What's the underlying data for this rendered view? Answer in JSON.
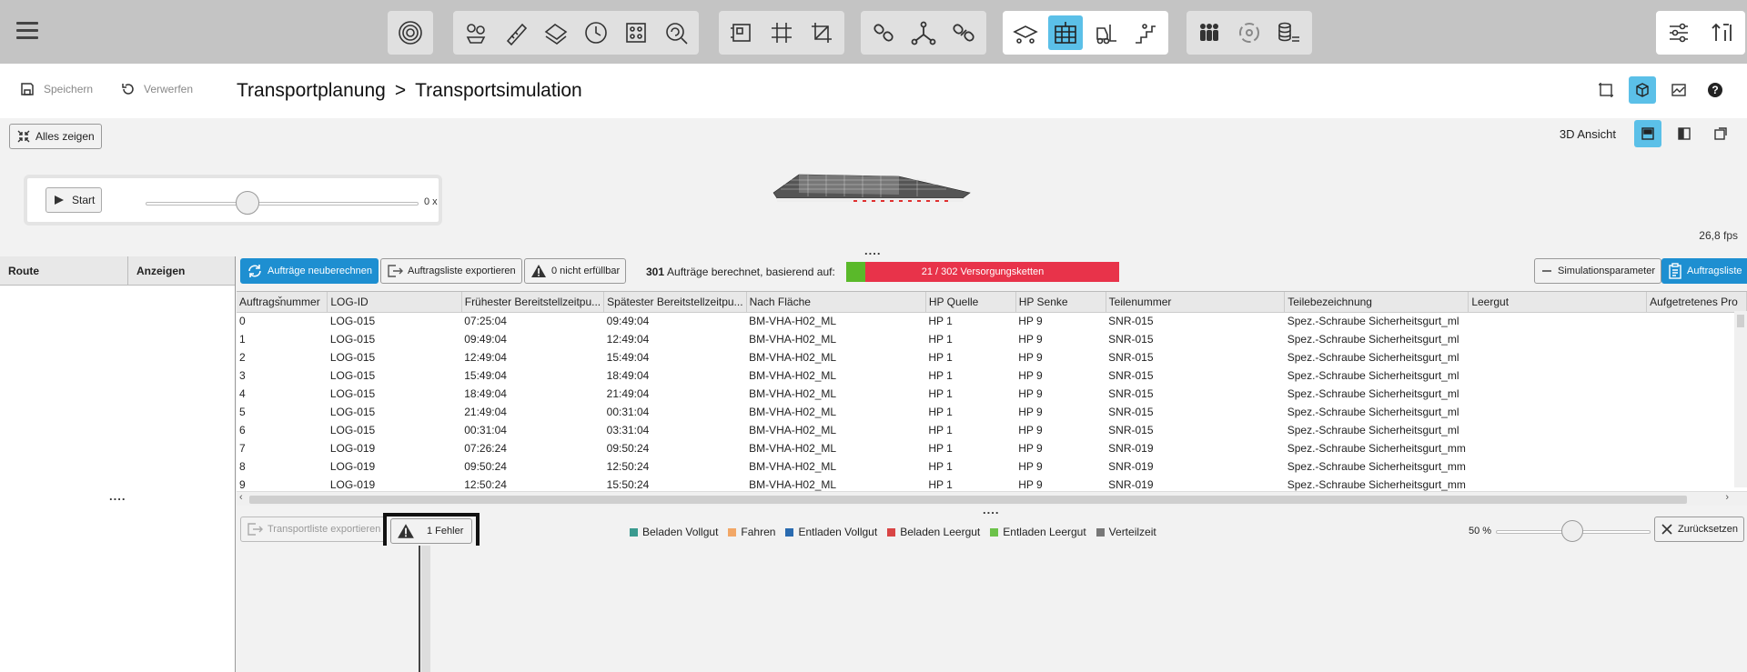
{
  "toolbar": {
    "groups": [
      {
        "icons": [
          "target-icon"
        ]
      },
      {
        "icons": [
          "molecule-icon",
          "ruler-pencil-icon",
          "layers-icon",
          "clock-icon",
          "grid-dots-icon",
          "search-refresh-icon"
        ]
      },
      {
        "icons": [
          "layout-frame-icon",
          "grid-icon",
          "crop-icon"
        ]
      },
      {
        "icons": [
          "link-icon",
          "branch-icon",
          "link-chain-icon"
        ]
      },
      {
        "icons": [
          "truck-unload-icon",
          "table-grid-icon",
          "forklift-icon",
          "stairs-icon"
        ]
      },
      {
        "icons": [
          "people-icon",
          "cycle-icon",
          "coins-icon"
        ]
      },
      {
        "icons": [
          "sliders-icon",
          "sort-icon"
        ]
      }
    ]
  },
  "actions": {
    "save": "Speichern",
    "discard": "Verwerfen"
  },
  "breadcrumb": {
    "part1": "Transportplanung",
    "separator": ">",
    "part2": "Transportsimulation"
  },
  "view3d": {
    "show_all": "Alles zeigen",
    "label": "3D Ansicht",
    "start": "Start",
    "speed": "0 x",
    "fps": "26,8 fps"
  },
  "left_panel": {
    "col_route": "Route",
    "col_show": "Anzeigen",
    "dots": "...."
  },
  "main": {
    "recalculate": "Aufträge neuberechnen",
    "export_orders": "Auftragsliste exportieren",
    "not_feasible": "0 nicht erfüllbar",
    "computed_count": "301",
    "computed_text": "Aufträge berechnet, basierend auf:",
    "progress_text": "21 / 302 Versorgungsketten",
    "progress_fraction": 0.0695,
    "sim_params": "Simulationsparameter",
    "order_list": "Auftragsliste",
    "dots": "....",
    "accent": "#1e8fd1",
    "progress_ok": "#5ab92a",
    "progress_bad": "#e8334a"
  },
  "table": {
    "headers": [
      "Auftragsnummer",
      "LOG-ID",
      "Frühester Bereitstellzeitpu...",
      "Spätester Bereitstellzeitpu...",
      "Nach Fläche",
      "HP Quelle",
      "HP Senke",
      "Teilenummer",
      "Teilebezeichnung",
      "Leergut",
      "Aufgetretenes Pro"
    ],
    "rows": [
      [
        "0",
        "LOG-015",
        "07:25:04",
        "09:49:04",
        "BM-VHA-H02_ML",
        "HP 1",
        "HP 9",
        "SNR-015",
        "Spez.-Schraube Sicherheitsgurt_ml",
        "",
        ""
      ],
      [
        "1",
        "LOG-015",
        "09:49:04",
        "12:49:04",
        "BM-VHA-H02_ML",
        "HP 1",
        "HP 9",
        "SNR-015",
        "Spez.-Schraube Sicherheitsgurt_ml",
        "",
        ""
      ],
      [
        "2",
        "LOG-015",
        "12:49:04",
        "15:49:04",
        "BM-VHA-H02_ML",
        "HP 1",
        "HP 9",
        "SNR-015",
        "Spez.-Schraube Sicherheitsgurt_ml",
        "",
        ""
      ],
      [
        "3",
        "LOG-015",
        "15:49:04",
        "18:49:04",
        "BM-VHA-H02_ML",
        "HP 1",
        "HP 9",
        "SNR-015",
        "Spez.-Schraube Sicherheitsgurt_ml",
        "",
        ""
      ],
      [
        "4",
        "LOG-015",
        "18:49:04",
        "21:49:04",
        "BM-VHA-H02_ML",
        "HP 1",
        "HP 9",
        "SNR-015",
        "Spez.-Schraube Sicherheitsgurt_ml",
        "",
        ""
      ],
      [
        "5",
        "LOG-015",
        "21:49:04",
        "00:31:04",
        "BM-VHA-H02_ML",
        "HP 1",
        "HP 9",
        "SNR-015",
        "Spez.-Schraube Sicherheitsgurt_ml",
        "",
        ""
      ],
      [
        "6",
        "LOG-015",
        "00:31:04",
        "03:31:04",
        "BM-VHA-H02_ML",
        "HP 1",
        "HP 9",
        "SNR-015",
        "Spez.-Schraube Sicherheitsgurt_ml",
        "",
        ""
      ],
      [
        "7",
        "LOG-019",
        "07:26:24",
        "09:50:24",
        "BM-VHA-H02_ML",
        "HP 1",
        "HP 9",
        "SNR-019",
        "Spez.-Schraube Sicherheitsgurt_mm",
        "",
        ""
      ],
      [
        "8",
        "LOG-019",
        "09:50:24",
        "12:50:24",
        "BM-VHA-H02_ML",
        "HP 1",
        "HP 9",
        "SNR-019",
        "Spez.-Schraube Sicherheitsgurt_mm",
        "",
        ""
      ],
      [
        "9",
        "LOG-019",
        "12:50:24",
        "15:50:24",
        "BM-VHA-H02_ML",
        "HP 1",
        "HP 9",
        "SNR-019",
        "Spez.-Schraube Sicherheitsgurt_mm",
        "",
        ""
      ]
    ]
  },
  "bottom": {
    "export_transport": "Transportliste exportieren",
    "errors": "1 Fehler",
    "legend": [
      {
        "label": "Beladen Vollgut",
        "color": "#3a9a8f"
      },
      {
        "label": "Fahren",
        "color": "#f2a766"
      },
      {
        "label": "Entladen Vollgut",
        "color": "#2a6bb0"
      },
      {
        "label": "Beladen Leergut",
        "color": "#d94545"
      },
      {
        "label": "Entladen Leergut",
        "color": "#6cc24a"
      },
      {
        "label": "Verteilzeit",
        "color": "#777777"
      }
    ],
    "zoom": "50 %",
    "reset": "Zurücksetzen"
  }
}
